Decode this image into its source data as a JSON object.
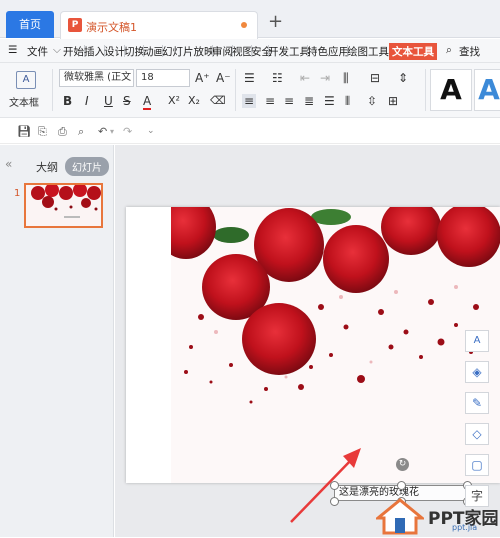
{
  "tabs": {
    "home_label": "首页",
    "doc_icon": "P",
    "doc_title": "演示文稿1",
    "add_label": "+"
  },
  "menu": {
    "file_label": "文件",
    "items": [
      "开始",
      "插入",
      "设计",
      "切换",
      "动画",
      "幻灯片放映",
      "审阅",
      "视图",
      "安全",
      "开发工具",
      "特色应用",
      "绘图工具"
    ],
    "active_item": "文本工具",
    "search_label": "查找"
  },
  "ribbon": {
    "textbox_icon": "A",
    "textbox_label": "文本框",
    "font_name": "微软雅黑 (正文",
    "font_size": "18",
    "grow_font": "A⁺",
    "shrink_font": "A⁻",
    "bold": "B",
    "italic": "I",
    "underline": "U",
    "strike": "S",
    "font_color": "A",
    "superscript": "X²",
    "subscript": "X₂",
    "clear_format": "⌫",
    "style_a_black": "A",
    "style_a_blue": "A"
  },
  "sidebar": {
    "collapse": "«",
    "outline_label": "大纲",
    "slides_label": "幻灯片",
    "thumb_number": "1"
  },
  "slide": {
    "textbox_text": "这是漂亮的玫瑰花"
  },
  "watermark": {
    "brand": "PPT家园",
    "url": "ppt.jia"
  },
  "colors": {
    "accent_orange": "#e8553c",
    "home_tab_blue": "#2b78e4",
    "rose_red": "#c8131f",
    "arrow_red": "#e83a3a"
  }
}
